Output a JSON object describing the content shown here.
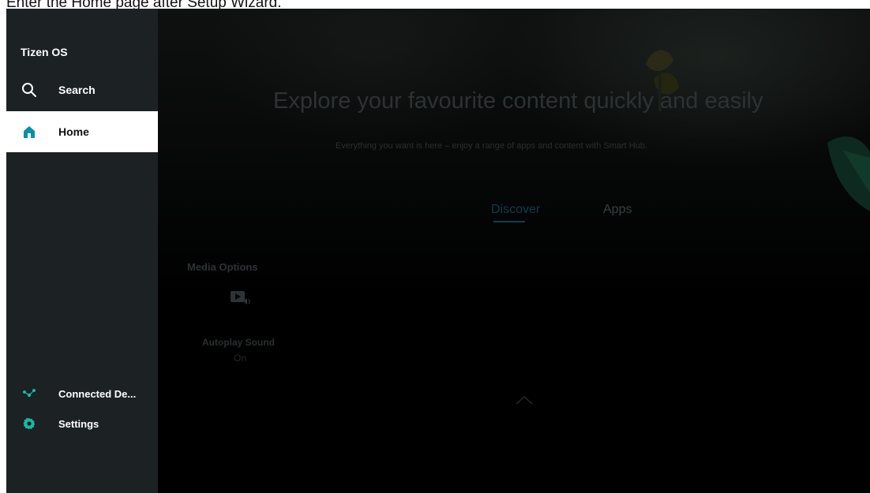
{
  "caption": "Enter the Home page after Setup Wizard.",
  "sidebar": {
    "brand": "Tizen OS",
    "items": [
      {
        "label": "Search",
        "icon": "search-icon"
      },
      {
        "label": "Home",
        "icon": "home-icon",
        "active": true
      }
    ],
    "bottom_items": [
      {
        "label": "Connected De...",
        "icon": "connected-devices-icon"
      },
      {
        "label": "Settings",
        "icon": "gear-icon"
      }
    ]
  },
  "main": {
    "hero_title": "Explore your favourite content quickly and easily",
    "hero_subtitle": "Everything you want is here – enjoy a range of apps and content with Smart Hub.",
    "tabs": [
      {
        "label": "Discover",
        "selected": true
      },
      {
        "label": "Apps",
        "selected": false
      }
    ],
    "media_options": {
      "title": "Media Options",
      "icon": "media-play-sound-icon",
      "setting_label": "Autoplay Sound",
      "setting_value": "On"
    },
    "scroll_indicator_icon": "chevron-up-icon"
  },
  "colors": {
    "sidebar_bg": "#1c2124",
    "active_bg": "#ffffff",
    "accent": "#0d8fa8",
    "screen_bg": "#000000"
  }
}
